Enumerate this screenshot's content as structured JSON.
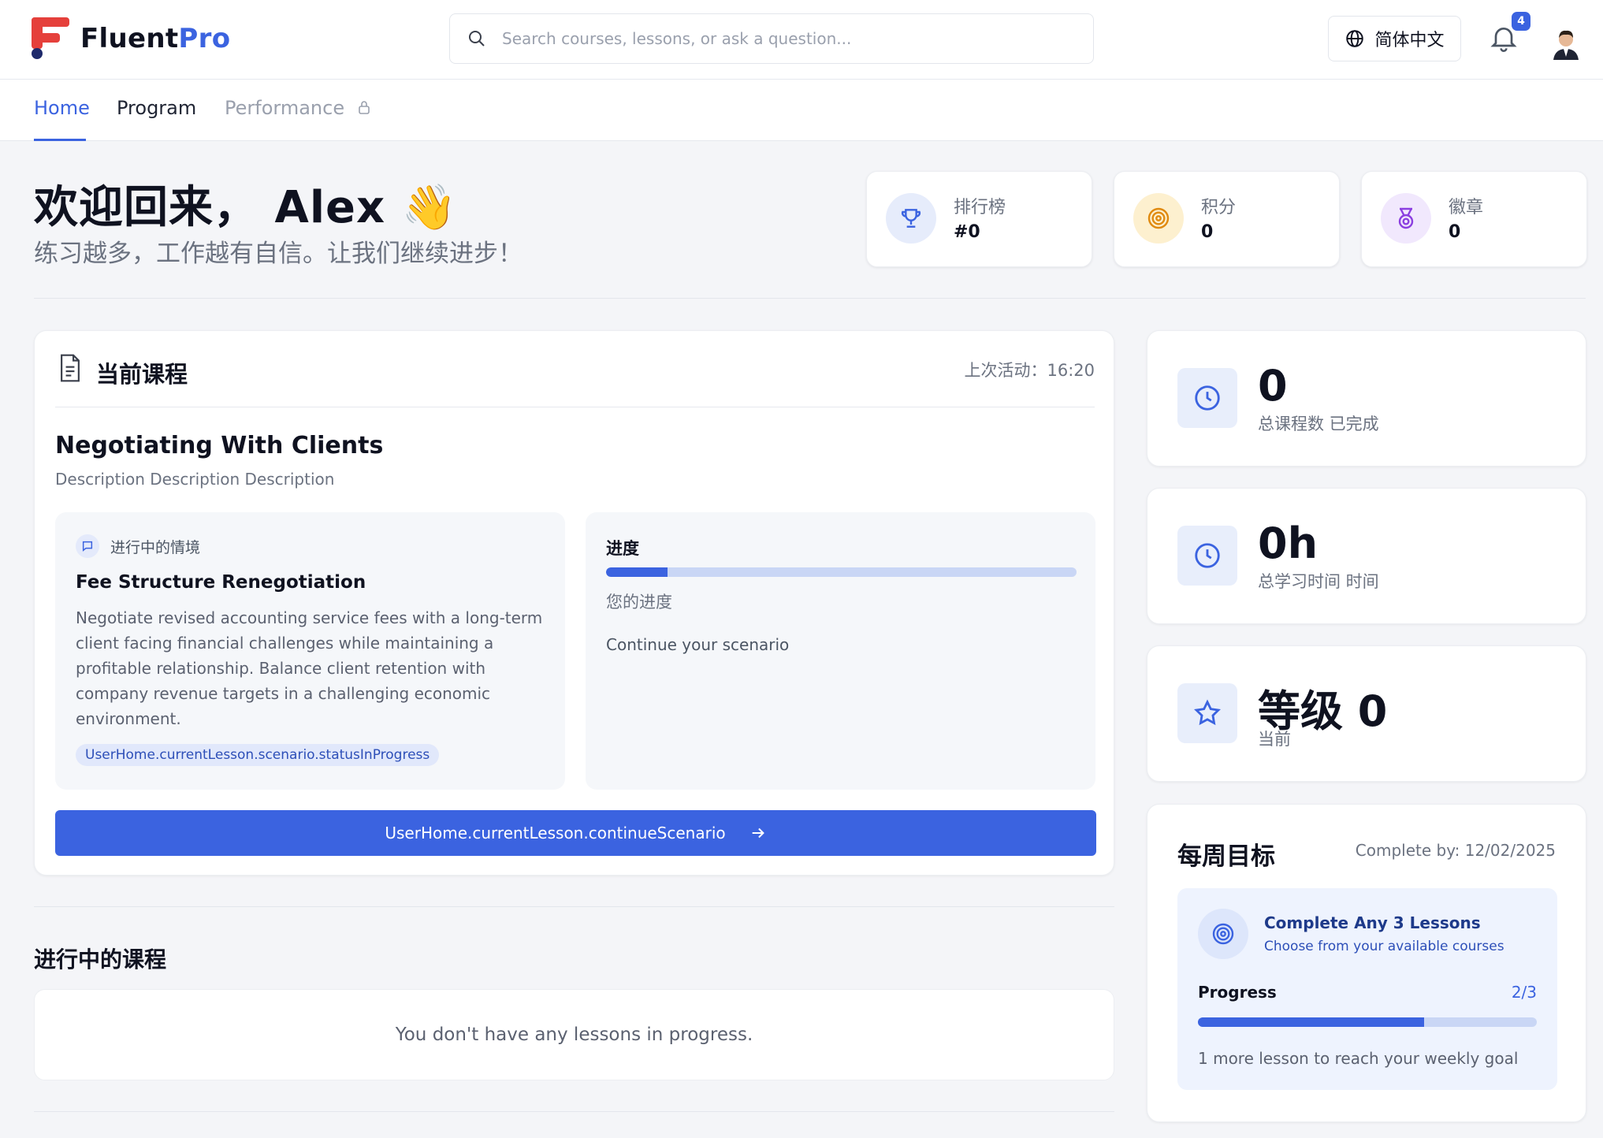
{
  "brand": {
    "name_part1": "Fluent",
    "name_part2": "Pro"
  },
  "search": {
    "placeholder": "Search courses, lessons, or ask a question..."
  },
  "language": {
    "label": "简体中文"
  },
  "notifications": {
    "count": "4"
  },
  "nav": {
    "tabs": [
      {
        "label": "Home"
      },
      {
        "label": "Program"
      },
      {
        "label": "Performance"
      }
    ]
  },
  "welcome": {
    "title": "欢迎回来， Alex",
    "emoji": "👋",
    "subtitle": "练习越多，工作越有自信。让我们继续进步！"
  },
  "stats": [
    {
      "label": "排行榜",
      "value": "#0"
    },
    {
      "label": "积分",
      "value": "0"
    },
    {
      "label": "徽章",
      "value": "0"
    }
  ],
  "current_course": {
    "header": "当前课程",
    "last_activity": "上次活动：16:20",
    "title": "Negotiating With Clients",
    "description": "Description Description Description",
    "scenario": {
      "label": "进行中的情境",
      "title": "Fee Structure Renegotiation",
      "description": "Negotiate revised accounting service fees with a long-term client facing financial challenges while maintaining a profitable relationship. Balance client retention with company revenue targets in a challenging economic environment.",
      "status_tag": "UserHome.currentLesson.scenario.statusInProgress"
    },
    "progress": {
      "title": "进度",
      "fraction": 0.13,
      "your_progress": "您的进度",
      "continue_text": "Continue your scenario"
    },
    "cta_label": "UserHome.currentLesson.continueScenario"
  },
  "in_progress": {
    "title": "进行中的课程",
    "empty_text": "You don't have any lessons in progress."
  },
  "summary": [
    {
      "value": "0",
      "label": "总课程数 已完成",
      "icon": "clock-icon"
    },
    {
      "value": "0h",
      "label": "总学习时间 时间",
      "icon": "clock-icon"
    },
    {
      "value": "等级 0",
      "label": "当前",
      "icon": "star-icon"
    }
  ],
  "weekly_goal": {
    "title": "每周目标",
    "complete_by": "Complete by: 12/02/2025",
    "goal_title": "Complete Any 3 Lessons",
    "goal_sub": "Choose from your available courses",
    "progress_label": "Progress",
    "progress_count": "2/3",
    "progress_fraction": 0.667,
    "note": "1 more lesson to reach your weekly goal"
  },
  "colors": {
    "accent": "#3b63e0",
    "brand_red": "#e5403b",
    "brand_navy": "#1e2a6b"
  }
}
